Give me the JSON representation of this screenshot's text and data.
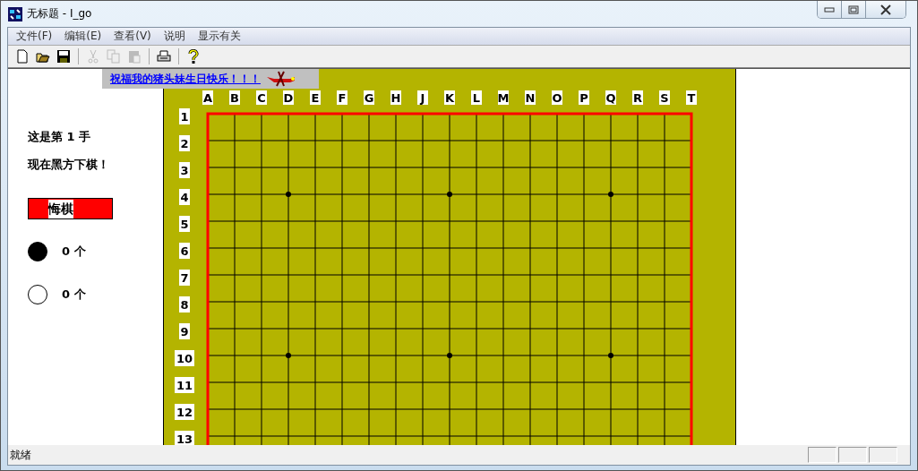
{
  "window": {
    "title": "无标题 - I_go"
  },
  "menu": [
    "文件(F)",
    "编辑(E)",
    "查看(V)",
    "说明",
    "显示有关"
  ],
  "toolbar": [
    {
      "kind": "new",
      "disabled": false
    },
    {
      "kind": "open",
      "disabled": false
    },
    {
      "kind": "save",
      "disabled": false
    },
    {
      "kind": "separator"
    },
    {
      "kind": "cut",
      "disabled": true
    },
    {
      "kind": "copy",
      "disabled": true
    },
    {
      "kind": "paste",
      "disabled": true
    },
    {
      "kind": "separator"
    },
    {
      "kind": "print",
      "disabled": false
    },
    {
      "kind": "separator"
    },
    {
      "kind": "help",
      "disabled": false
    }
  ],
  "banner": {
    "link": "祝福我的猪头妹生日快乐！！！"
  },
  "info": {
    "move_text": "这是第 1 手",
    "turn_text": "现在黑方下棋！",
    "undo_button": "悔棋",
    "black_count": "0 个",
    "white_count": "0 个"
  },
  "board": {
    "columns": [
      "A",
      "B",
      "C",
      "D",
      "E",
      "F",
      "G",
      "H",
      "J",
      "K",
      "L",
      "M",
      "N",
      "O",
      "P",
      "Q",
      "R",
      "S",
      "T"
    ],
    "rows": [
      "1",
      "2",
      "3",
      "4",
      "5",
      "6",
      "7",
      "8",
      "9",
      "10",
      "11",
      "12",
      "13"
    ]
  },
  "status_bar": {
    "text": "就绪"
  }
}
